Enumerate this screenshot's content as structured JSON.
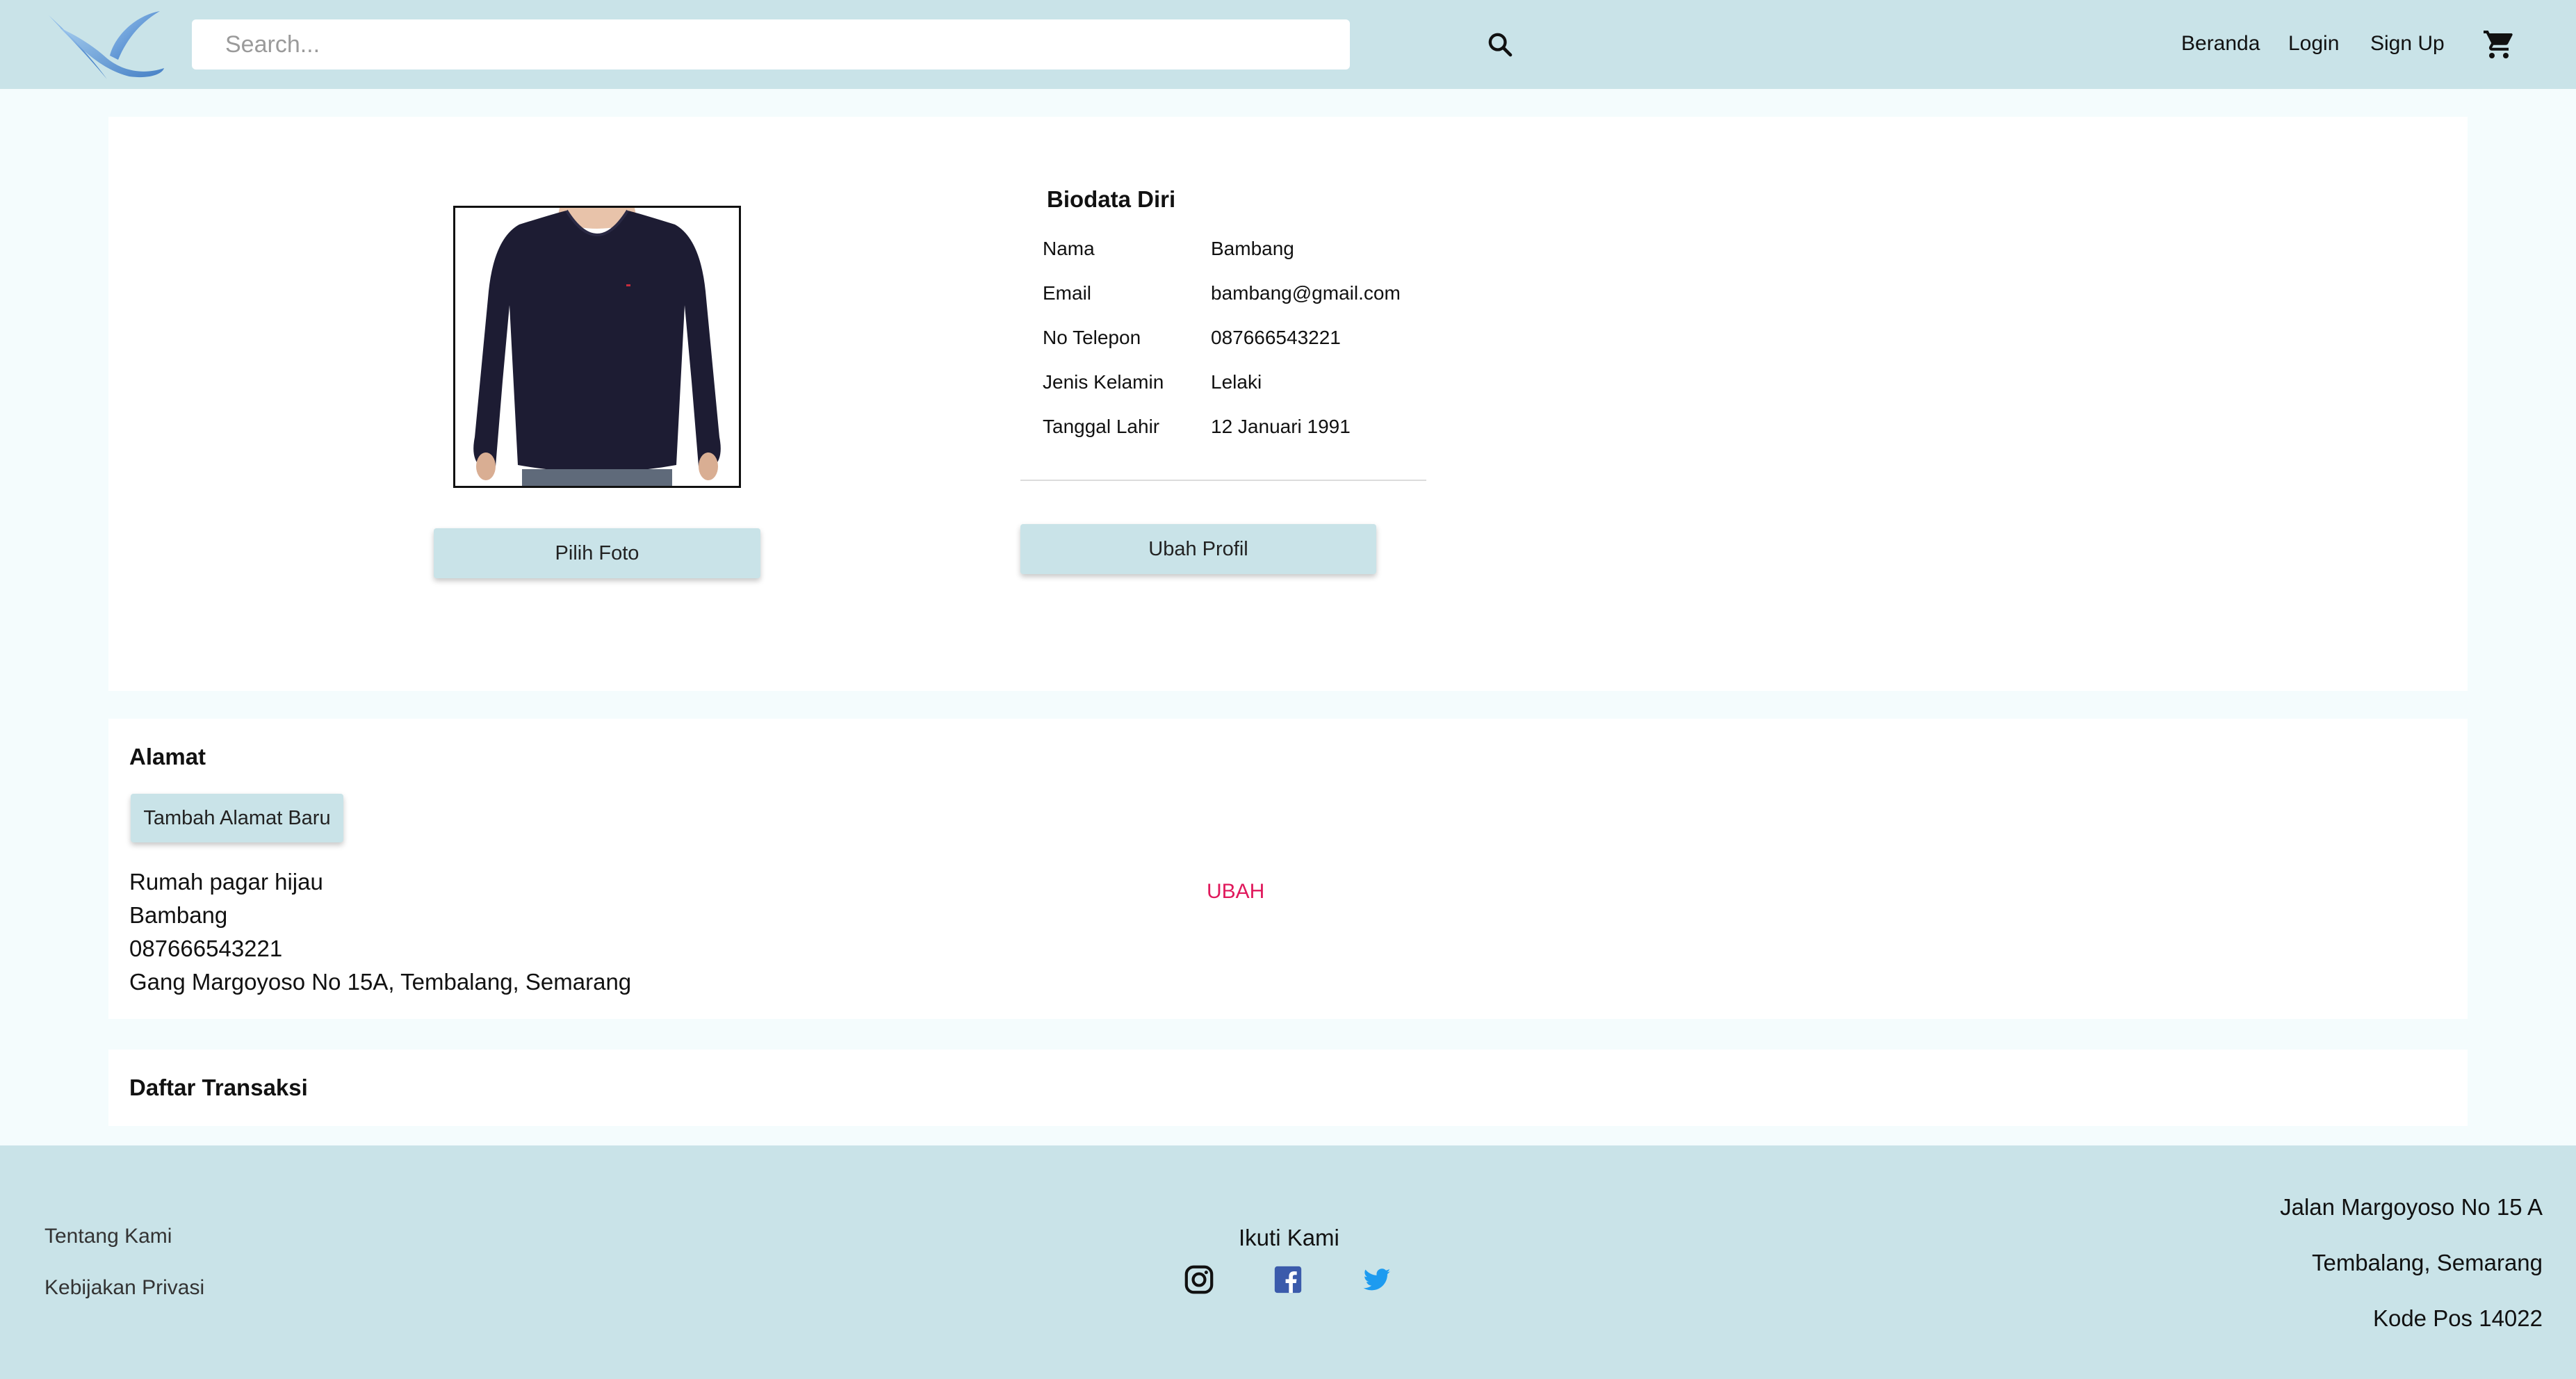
{
  "header": {
    "search_placeholder": "Search...",
    "nav": {
      "home": "Beranda",
      "login": "Login",
      "signup": "Sign Up"
    }
  },
  "profile": {
    "choose_photo_label": "Pilih Foto",
    "biodata_title": "Biodata Diri",
    "fields": [
      {
        "label": "Nama",
        "value": "Bambang"
      },
      {
        "label": "Email",
        "value": "bambang@gmail.com"
      },
      {
        "label": "No Telepon",
        "value": "087666543221"
      },
      {
        "label": "Jenis Kelamin",
        "value": "Lelaki"
      },
      {
        "label": "Tanggal Lahir",
        "value": "12 Januari 1991"
      }
    ],
    "edit_profile_label": "Ubah Profil"
  },
  "address": {
    "title": "Alamat",
    "add_label": "Tambah Alamat Baru",
    "lines": [
      "Rumah pagar hijau",
      "Bambang",
      "087666543221",
      "Gang Margoyoso No 15A, Tembalang, Semarang"
    ],
    "edit_label": "UBAH"
  },
  "transactions": {
    "title": "Daftar Transaksi"
  },
  "footer": {
    "links": [
      "Tentang Kami",
      "Kebijakan Privasi"
    ],
    "follow_title": "Ikuti Kami",
    "address_lines": [
      "Jalan Margoyoso No 15 A",
      "Tembalang, Semarang",
      "Kode Pos 14022"
    ]
  },
  "colors": {
    "header_bg": "#c9e3e8",
    "page_bg": "#f4fcfd",
    "accent_link": "#e0195c",
    "facebook": "#3b5bab",
    "twitter": "#1d9bf0"
  },
  "icons": [
    "bird-logo",
    "search-icon",
    "cart-icon",
    "instagram-icon",
    "facebook-icon",
    "twitter-icon"
  ]
}
